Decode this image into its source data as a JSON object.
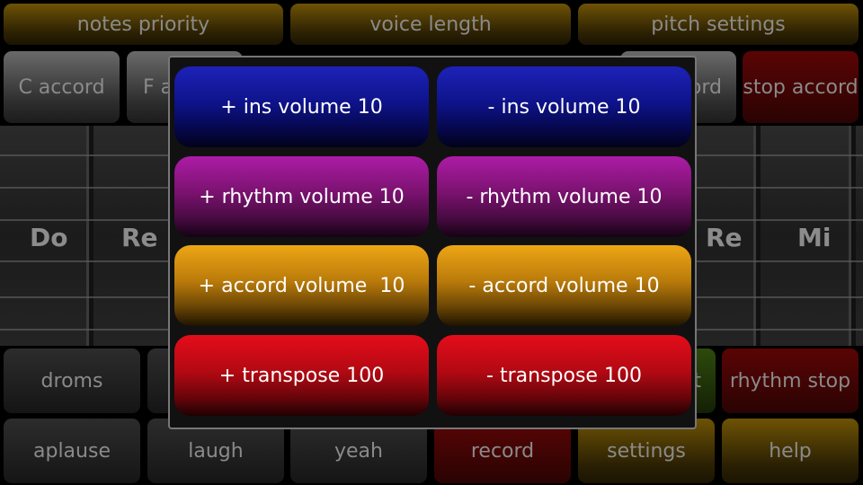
{
  "top_bar": {
    "notes_priority": "notes priority",
    "voice_length": "voice length",
    "pitch_settings": "pitch settings"
  },
  "accord_row": {
    "c_accord": "C accord",
    "f_accord_partial": "F a",
    "hidden_accord_partial": "ord",
    "stop_accord": "stop accord"
  },
  "fretboard": {
    "notes_left": [
      "Do",
      "Re"
    ],
    "notes_right": [
      "Re",
      "Mi"
    ]
  },
  "rhythm_row": {
    "droms": "droms",
    "hidden_partial": "t",
    "rhythm_stop": "rhythm stop"
  },
  "bottom_bar": {
    "aplause": "aplause",
    "laugh": "laugh",
    "yeah": "yeah",
    "record": "record",
    "settings": "settings",
    "help": "help"
  },
  "dialog": {
    "ins_up": "+ ins volume 10",
    "ins_down": "- ins volume 10",
    "rhythm_up": "+ rhythm volume 10",
    "rhythm_down": "- rhythm volume 10",
    "accord_up": "+ accord volume  10",
    "accord_down": "- accord volume 10",
    "transpose_up": "+ transpose 100",
    "transpose_down": "- transpose 100"
  }
}
